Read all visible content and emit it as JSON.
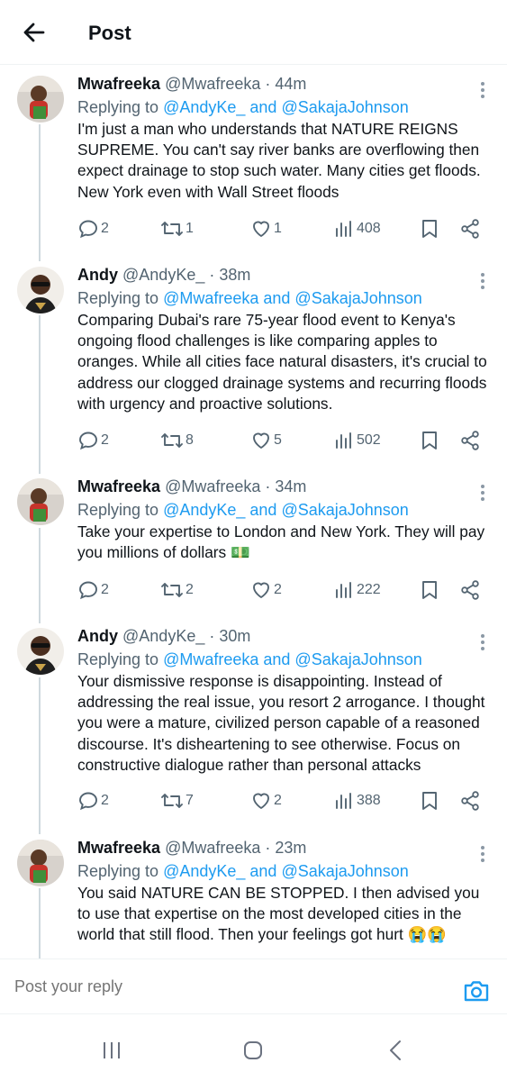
{
  "header": {
    "title": "Post",
    "back_icon": "arrow-left-icon"
  },
  "tweets": [
    {
      "name": "Mwafreeka",
      "handle": "@Mwafreeka",
      "time": "· 44m",
      "replying_prefix": "Replying to",
      "replying_to": "@AndyKe_ and @SakajaJohnson",
      "text": "I'm just a man who understands that NATURE REIGNS SUPREME. You can't say river banks are overflowing then expect drainage to stop such water. Many cities get floods. New York even with Wall Street floods",
      "replies": "2",
      "reposts": "1",
      "likes": "1",
      "views": "408"
    },
    {
      "name": "Andy",
      "handle": "@AndyKe_",
      "time": "· 38m",
      "replying_prefix": "Replying to",
      "replying_to": "@Mwafreeka and @SakajaJohnson",
      "text": "Comparing Dubai's rare 75-year flood event to Kenya's ongoing flood challenges is like comparing apples to oranges. While all cities face natural disasters, it's crucial to address our clogged drainage systems and recurring floods with urgency and proactive solutions.",
      "replies": "2",
      "reposts": "8",
      "likes": "5",
      "views": "502"
    },
    {
      "name": "Mwafreeka",
      "handle": "@Mwafreeka",
      "time": "· 34m",
      "replying_prefix": "Replying to",
      "replying_to": "@AndyKe_ and @SakajaJohnson",
      "text": "Take your expertise to London and New York. They will pay you millions of dollars 💵",
      "replies": "2",
      "reposts": "2",
      "likes": "2",
      "views": "222"
    },
    {
      "name": "Andy",
      "handle": "@AndyKe_",
      "time": "· 30m",
      "replying_prefix": "Replying to",
      "replying_to": "@Mwafreeka and @SakajaJohnson",
      "text": "Your dismissive response is disappointing. Instead of addressing the real issue, you resort 2 arrogance. I thought you were a mature, civilized person capable of a reasoned discourse. It's disheartening to see otherwise. Focus on constructive dialogue rather than personal attacks",
      "replies": "2",
      "reposts": "7",
      "likes": "2",
      "views": "388"
    },
    {
      "name": "Mwafreeka",
      "handle": "@Mwafreeka",
      "time": "· 23m",
      "replying_prefix": "Replying to",
      "replying_to": "@AndyKe_ and @SakajaJohnson",
      "text": "You said NATURE CAN BE STOPPED. I then advised you to use that expertise on the most developed cities in the world that still flood. Then your feelings got hurt 😭😭"
    }
  ],
  "composer": {
    "placeholder": "Post your reply",
    "camera_icon": "camera-icon"
  },
  "navbar": {
    "icons": [
      "recent-apps-icon",
      "home-icon",
      "back-icon"
    ]
  },
  "colors": {
    "link": "#1d9bf0",
    "muted": "#536471",
    "text": "#0f1419",
    "thread": "#cfd9de"
  }
}
